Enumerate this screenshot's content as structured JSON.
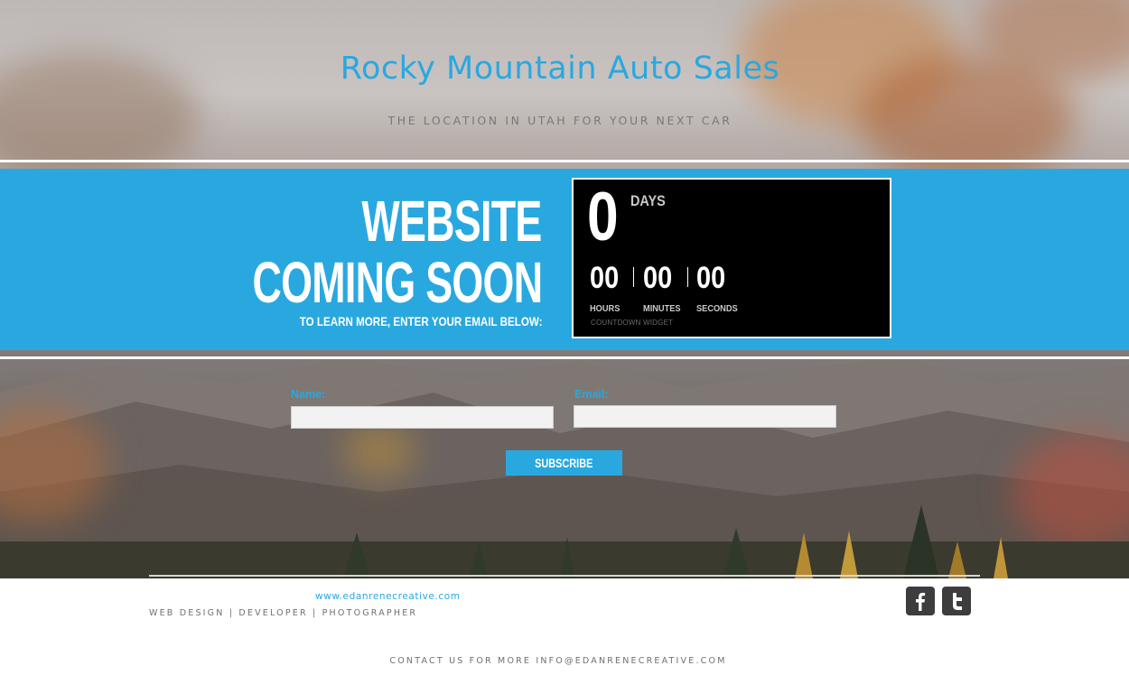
{
  "header": {
    "title": "Rocky Mountain Auto Sales",
    "tagline": "THE LOCATION IN UTAH FOR YOUR NEXT CAR"
  },
  "banner": {
    "line1": "WEBSITE",
    "line2": "COMING SOON",
    "subline": "TO LEARN MORE, ENTER YOUR EMAIL BELOW:"
  },
  "countdown": {
    "days_value": "0",
    "days_label": "DAYS",
    "hours_value": "00",
    "hours_label": "HOURS",
    "minutes_value": "00",
    "minutes_label": "MINUTES",
    "seconds_value": "00",
    "seconds_label": "SECONDS",
    "credit": "COUNTDOWN WIDGET"
  },
  "form": {
    "name_label": "Name:",
    "name_value": "",
    "email_label": "Email:",
    "email_value": "",
    "subscribe_label": "SUBSCRIBE"
  },
  "footer": {
    "link": "www.edanrenecreative.com",
    "services": "WEB DESIGN | DEVELOPER | PHOTOGRAPHER",
    "contact": "CONTACT US FOR MORE INFO@EDANRENECREATIVE.COM",
    "social": [
      {
        "icon": "facebook-icon",
        "glyph": "f"
      },
      {
        "icon": "twitter-icon",
        "glyph": "t"
      }
    ]
  },
  "colors": {
    "accent": "#29a8e0",
    "countdown_bg": "#000000",
    "social_bg": "#3d3d3d",
    "footer_text": "#6f6f6f"
  }
}
